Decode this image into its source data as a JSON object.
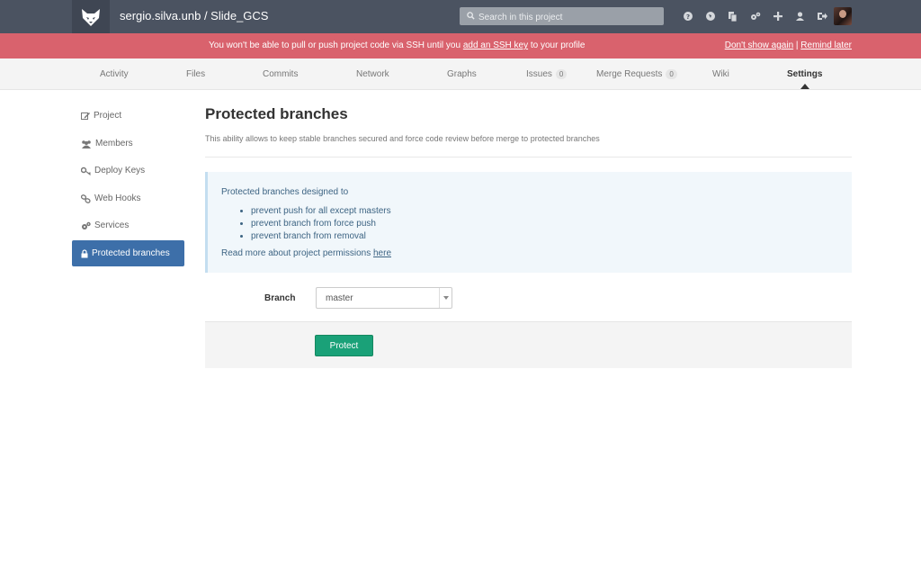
{
  "header": {
    "project_title": "sergio.silva.unb / Slide_GCS",
    "search_placeholder": "Search in this project",
    "icons": [
      "help-icon",
      "explore-icon",
      "snippets-icon",
      "admin-icon",
      "new-project-icon",
      "profile-icon",
      "logout-icon"
    ]
  },
  "alert": {
    "message_before": "You won't be able to pull or push project code via SSH until you ",
    "link": "add an SSH key",
    "message_after": " to your profile",
    "dont_show": "Don't show again",
    "separator": " | ",
    "remind": "Remind later"
  },
  "nav": {
    "tabs": [
      {
        "label": "Activity"
      },
      {
        "label": "Files"
      },
      {
        "label": "Commits"
      },
      {
        "label": "Network"
      },
      {
        "label": "Graphs"
      },
      {
        "label": "Issues",
        "count": "0"
      },
      {
        "label": "Merge Requests",
        "count": "0"
      },
      {
        "label": "Wiki"
      },
      {
        "label": "Settings"
      }
    ]
  },
  "sidebar": {
    "items": [
      {
        "label": "Project",
        "icon": "edit-icon"
      },
      {
        "label": "Members",
        "icon": "group-icon"
      },
      {
        "label": "Deploy Keys",
        "icon": "key-icon"
      },
      {
        "label": "Web Hooks",
        "icon": "link-icon"
      },
      {
        "label": "Services",
        "icon": "cogs-icon"
      },
      {
        "label": "Protected branches",
        "icon": "lock-icon"
      }
    ]
  },
  "main": {
    "title": "Protected branches",
    "description": "This ability allows to keep stable branches secured and force code review before merge to protected branches",
    "info": {
      "intro": "Protected branches designed to",
      "bullets": [
        "prevent push for all except masters",
        "prevent branch from force push",
        "prevent branch from removal"
      ],
      "read_more": "Read more about project permissions ",
      "read_more_link": "here"
    },
    "form": {
      "branch_label": "Branch",
      "branch_value": "master",
      "protect_button": "Protect"
    }
  },
  "colors": {
    "header_bg": "#4b5361",
    "alert_bg": "#d9626d",
    "active_sidebar": "#3d6fa9",
    "protect_button": "#1aa178"
  }
}
